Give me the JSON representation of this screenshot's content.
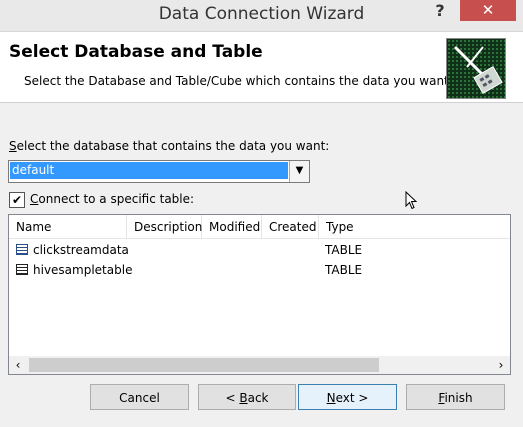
{
  "window": {
    "title": "Data Connection Wizard",
    "help": "?",
    "close": "✕"
  },
  "header": {
    "title": "Select Database and Table",
    "subtitle": "Select the Database and Table/Cube which contains the data you want."
  },
  "database": {
    "label_pre": "",
    "label_key": "S",
    "label_post": "elect the database that contains the data you want:",
    "selected": "default"
  },
  "specific_table": {
    "checked": true,
    "label_key": "C",
    "label_post": "onnect to a specific table:"
  },
  "table": {
    "columns": [
      "Name",
      "Description",
      "Modified",
      "Created",
      "Type"
    ],
    "rows": [
      {
        "name": "clickstreamdata",
        "description": "",
        "modified": "",
        "created": "",
        "type": "TABLE"
      },
      {
        "name": "hivesampletable",
        "description": "",
        "modified": "",
        "created": "",
        "type": "TABLE"
      }
    ]
  },
  "buttons": {
    "cancel": "Cancel",
    "back_pre": "< ",
    "back_key": "B",
    "back_post": "ack",
    "next_key": "N",
    "next_post": "ext >",
    "finish_key": "F",
    "finish_post": "inish"
  }
}
